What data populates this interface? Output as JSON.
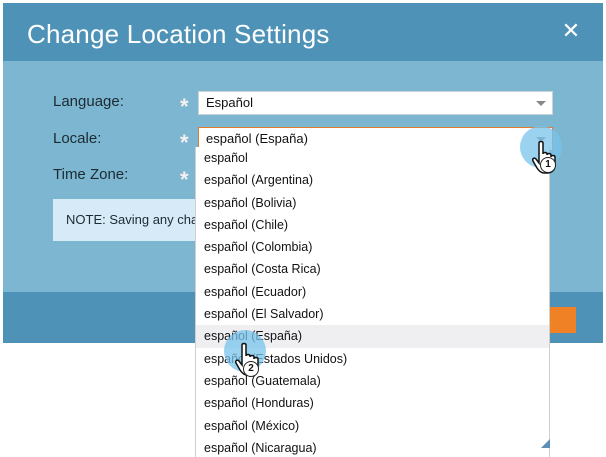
{
  "dialog": {
    "title": "Change Location Settings",
    "close_icon": "close-icon",
    "close_glyph": "✕"
  },
  "form": {
    "language_label": "Language:",
    "language_value": "Español",
    "locale_label": "Locale:",
    "locale_value": "español (España)",
    "timezone_label": "Time Zone:",
    "required_glyph": "*",
    "note_text": "NOTE:  Saving any cha"
  },
  "locale_dropdown": {
    "items": [
      "español",
      "español (Argentina)",
      "español (Bolivia)",
      "español (Chile)",
      "español (Colombia)",
      "español (Costa Rica)",
      "español (Ecuador)",
      "español (El Salvador)",
      "español (España)",
      "español (Estados Unidos)",
      "español (Guatemala)",
      "español (Honduras)",
      "español (México)",
      "español (Nicaragua)"
    ],
    "highlighted_index": 8
  },
  "annotations": {
    "step1": "1",
    "step2": "2"
  },
  "colors": {
    "header": "#4e93b7",
    "body": "#7cb6d1",
    "accent": "#f08125"
  }
}
